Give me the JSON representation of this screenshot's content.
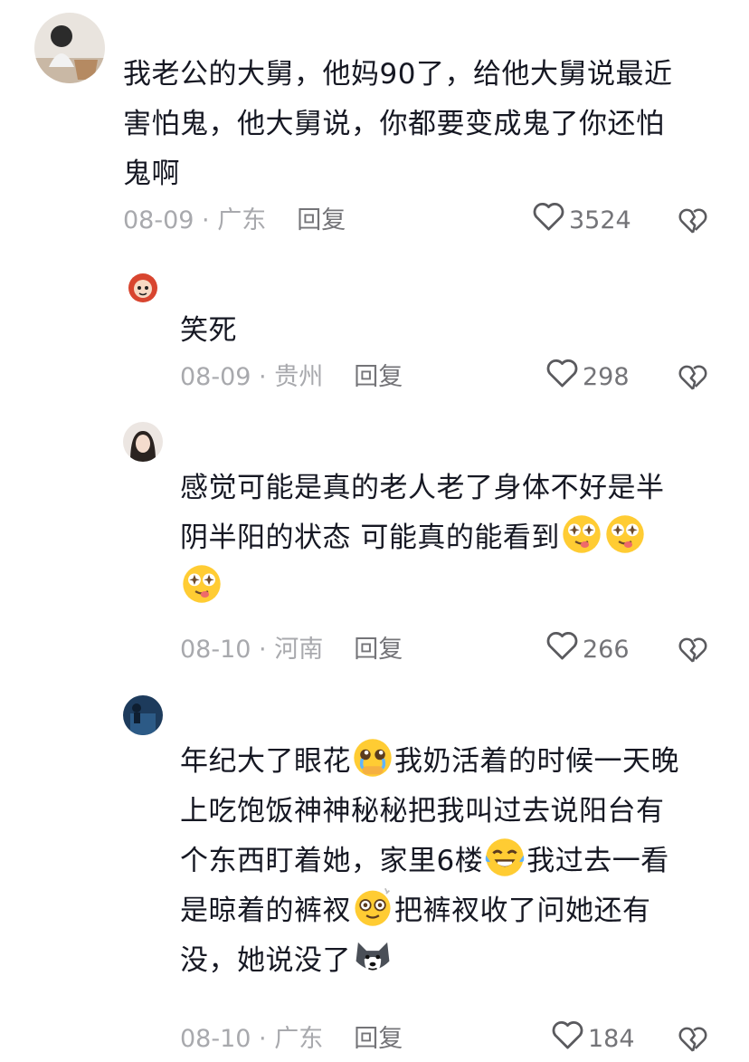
{
  "comments": [
    {
      "text_lines": [
        "我老公的大舅，他妈90了，给他大舅说最近",
        "害怕鬼，他大舅说，你都要变成鬼了你还怕",
        "鬼啊"
      ],
      "date": "08-09",
      "location": "广东",
      "reply_label": "回复",
      "likes": "3524"
    },
    {
      "text_lines": [
        "笑死"
      ],
      "date": "08-09",
      "location": "贵州",
      "reply_label": "回复",
      "likes": "298"
    },
    {
      "text_lines": [
        "感觉可能是真的老人老了身体不好是半",
        "阴半阳的状态 可能真的能看到"
      ],
      "date": "08-10",
      "location": "河南",
      "reply_label": "回复",
      "likes": "266"
    },
    {
      "text_parts": {
        "l1a": "年纪大了眼花",
        "l1b": "我奶活着的时候一天晚",
        "l2": "上吃饱饭神神秘秘把我叫过去说阳台有",
        "l3a": "个东西盯着她，家里6楼",
        "l3b": "我过去一看",
        "l4a": "是晾着的裤衩",
        "l4b": "把裤衩收了问她还有",
        "l5": "没，她说没了"
      },
      "date": "08-10",
      "location": "广东",
      "reply_label": "回复",
      "likes": "184"
    }
  ],
  "separator": " · ",
  "icons": {
    "like": "heart-outline-icon",
    "dislike": "broken-heart-icon",
    "emoji_stars": "star-eyes-tongue-emoji",
    "emoji_pleading": "pleading-face-emoji",
    "emoji_laugh_cry": "laughing-crying-emoji",
    "emoji_dizzy": "dizzy-face-emoji",
    "emoji_dog": "husky-doge-emoji"
  },
  "colors": {
    "text": "#161823",
    "meta": "#a8a9ad",
    "action": "#747478"
  }
}
